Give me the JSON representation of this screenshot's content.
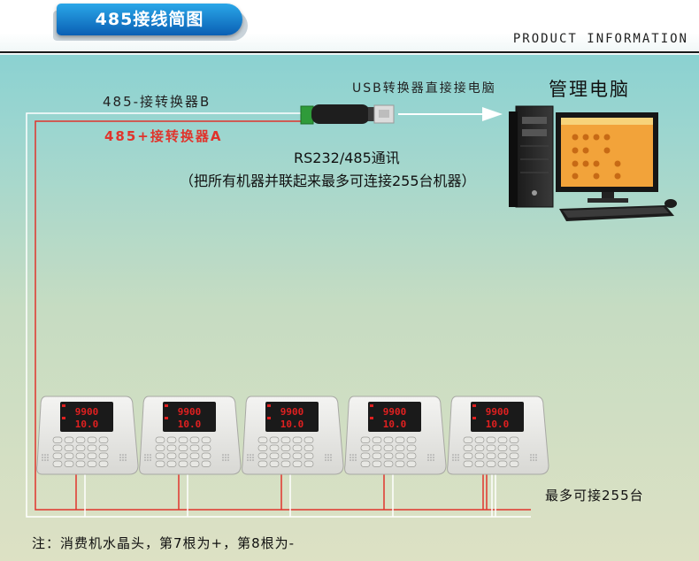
{
  "header": {
    "title": "485接线简图",
    "subtitle": "PRODUCT INFORMATION"
  },
  "labels": {
    "wire_b": "485-接转换器B",
    "wire_a": "485+接转换器A",
    "usb_converter": "USB转换器直接接电脑",
    "pc": "管理电脑",
    "comm": "RS232/485通讯",
    "comm_note": "（把所有机器并联起来最多可连接255台机器）",
    "max_devices": "最多可接255台",
    "footnote": "注：消费机水晶头，第7根为+，第8根为-"
  },
  "terminal": {
    "display_top": "9900",
    "display_bottom": "10.0",
    "count_shown": 5
  },
  "colors": {
    "wire_a": "#e0342c",
    "wire_b": "#ffffff",
    "title_tab": "#0a5fb4",
    "display": "#e02020"
  }
}
